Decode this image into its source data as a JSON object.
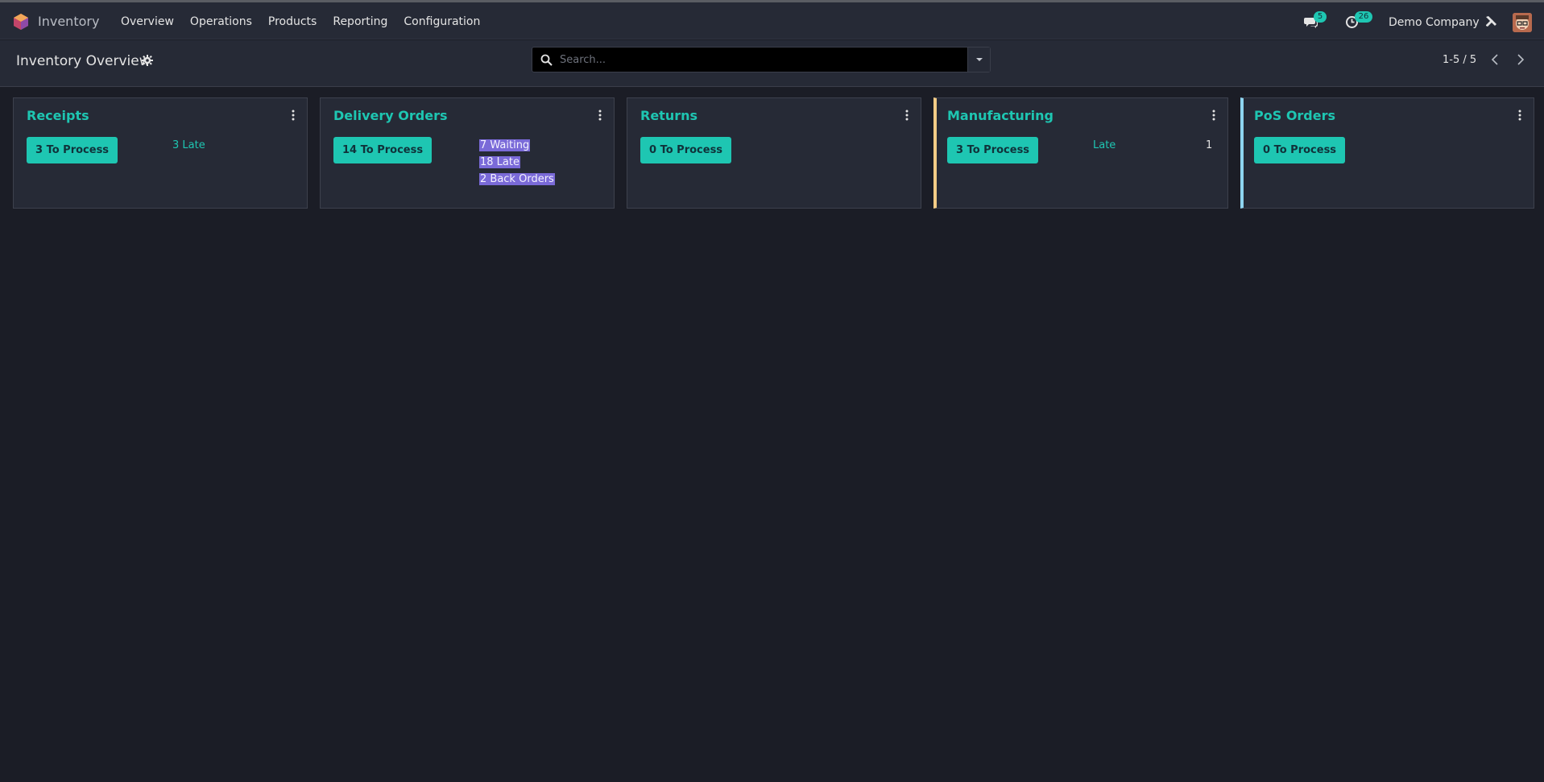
{
  "navbar": {
    "app_name": "Inventory",
    "menu": [
      "Overview",
      "Operations",
      "Products",
      "Reporting",
      "Configuration"
    ],
    "chat_badge": "5",
    "activity_badge": "26",
    "company": "Demo Company"
  },
  "control_panel": {
    "title": "Inventory Overview",
    "search_placeholder": "Search...",
    "pager": "1-5 / 5"
  },
  "cards": [
    {
      "title": "Receipts",
      "button": "3 To Process",
      "links": [
        "3 Late"
      ]
    },
    {
      "title": "Delivery Orders",
      "button": "14 To Process",
      "links": [
        "7 Waiting",
        "18 Late",
        "2 Back Orders"
      ]
    },
    {
      "title": "Returns",
      "button": "0 To Process",
      "links": []
    },
    {
      "title": "Manufacturing",
      "button": "3 To Process",
      "links": [
        "Late"
      ],
      "late_count": "1"
    },
    {
      "title": "PoS Orders",
      "button": "0 To Process",
      "links": []
    }
  ],
  "colors": {
    "background": "#1b1d26",
    "panel": "#262a36",
    "accent": "#1ec6b2",
    "highlight": "#7a6ad8",
    "manufacturing_border": "#f3cc86",
    "pos_border": "#8ed5f0"
  },
  "icons": [
    "odoo-logo-icon",
    "chat-icon",
    "clock-icon",
    "tools-icon",
    "gear-icon",
    "search-icon",
    "chevron-left-icon",
    "chevron-right-icon",
    "kebab-menu-icon"
  ]
}
